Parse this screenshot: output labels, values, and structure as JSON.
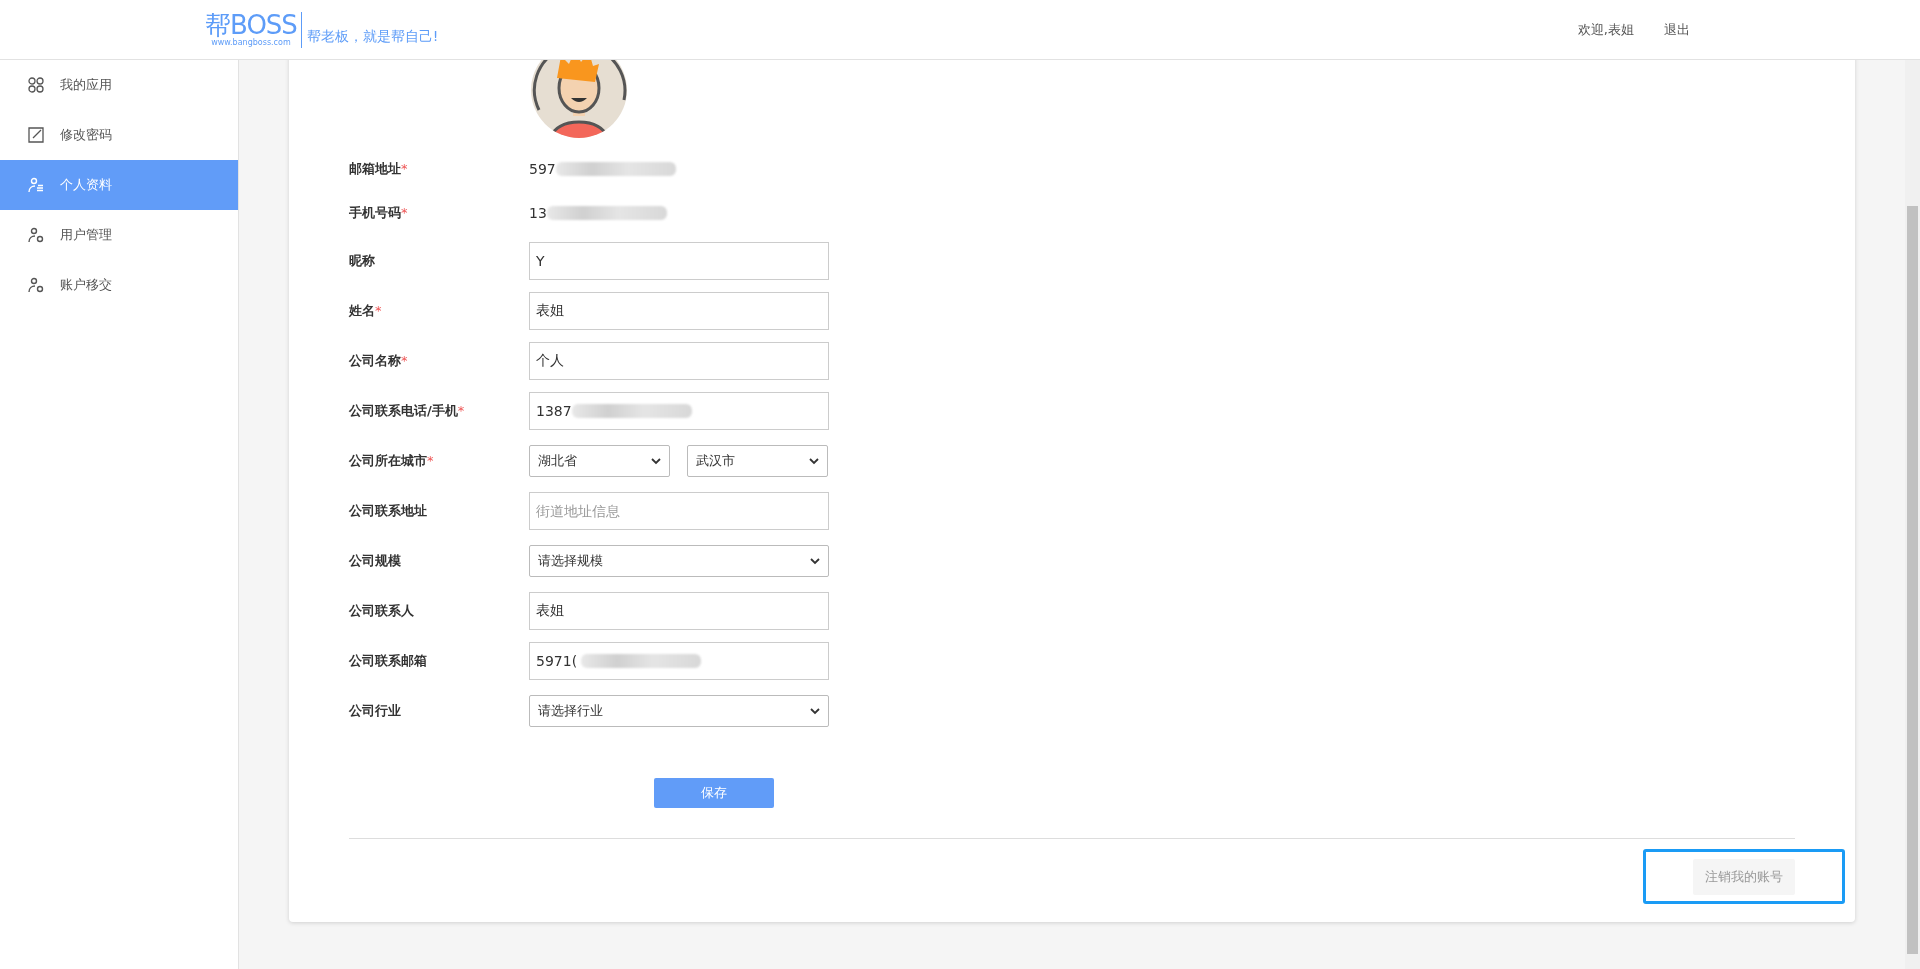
{
  "header": {
    "logo": {
      "mark": "帮BOSS",
      "url": "www.bangboss.com",
      "slogan": "帮老板，就是帮自己!"
    },
    "welcome": "欢迎,表姐",
    "logout": "退出"
  },
  "sidebar": {
    "items": [
      {
        "label": "我的应用",
        "kind": "apps",
        "selected": false
      },
      {
        "label": "修改密码",
        "kind": "edit",
        "selected": false
      },
      {
        "label": "个人资料",
        "kind": "profile",
        "selected": true
      },
      {
        "label": "用户管理",
        "kind": "users",
        "selected": false
      },
      {
        "label": "账户移交",
        "kind": "users",
        "selected": false
      }
    ]
  },
  "profile": {
    "fields": [
      {
        "label": "邮箱地址",
        "required_mark": "*",
        "kind": "static",
        "value": "597",
        "masked": true
      },
      {
        "label": "手机号码",
        "required_mark": "*",
        "kind": "static",
        "value": "13",
        "masked": true
      },
      {
        "label": "昵称",
        "kind": "input",
        "value": "Y"
      },
      {
        "label": "姓名",
        "required_mark": "*",
        "kind": "input",
        "value": "表姐"
      },
      {
        "label": "公司名称",
        "required_mark": "*",
        "kind": "input",
        "value": "个人"
      },
      {
        "label": "公司联系电话/手机",
        "required_mark": "*",
        "kind": "input",
        "value": "1387",
        "masked": true
      },
      {
        "label": "公司所在城市",
        "required_mark": "*",
        "kind": "select-pair",
        "values": [
          "湖北省",
          "武汉市"
        ]
      },
      {
        "label": "公司联系地址",
        "kind": "input",
        "placeholder": "街道地址信息"
      },
      {
        "label": "公司规模",
        "kind": "select",
        "values": [
          "请选择规模"
        ]
      },
      {
        "label": "公司联系人",
        "kind": "input",
        "value": "表姐"
      },
      {
        "label": "公司联系邮箱",
        "kind": "input",
        "value": "5971(",
        "masked": true
      },
      {
        "label": "公司行业",
        "kind": "select",
        "values": [
          "请选择行业"
        ]
      }
    ],
    "save": "保存",
    "deactivate": "注销我的账号",
    "deactivate_focused": true
  }
}
